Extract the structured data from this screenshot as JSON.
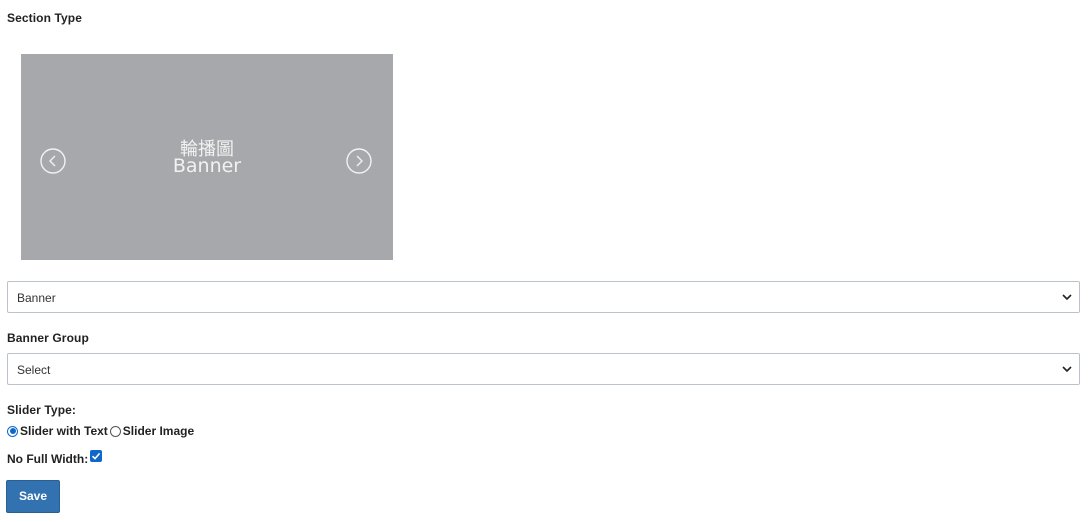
{
  "section_type": {
    "label": "Section Type",
    "preview": {
      "title_zh": "輪播圖",
      "title_en": "Banner",
      "prev_icon": "chevron-left-circle-icon",
      "next_icon": "chevron-right-circle-icon",
      "background": "#a7a8ab"
    },
    "selected": "Banner"
  },
  "banner_group": {
    "label": "Banner Group",
    "selected": "Select"
  },
  "slider_type": {
    "label": "Slider Type:",
    "options": [
      {
        "label": "Slider with Text",
        "checked": true
      },
      {
        "label": "Slider Image",
        "checked": false
      }
    ]
  },
  "full_width": {
    "label": "No Full Width:",
    "checked": true
  },
  "save": {
    "label": "Save"
  },
  "colors": {
    "accent": "#0f68c9",
    "button": "#3372b0"
  }
}
